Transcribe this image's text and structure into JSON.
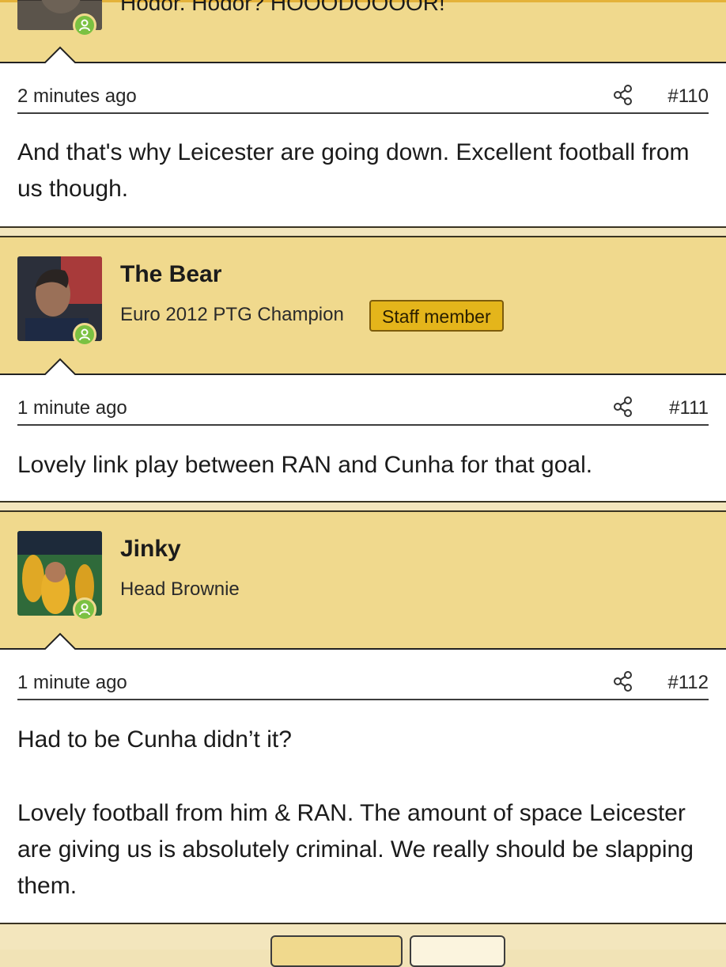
{
  "posts": [
    {
      "author_text": "Hodor. Hodor? HOOODOOOOR!",
      "time": "2 minutes ago",
      "number": "#110",
      "paragraphs": [
        "And that's why Leicester are going down. Excellent football from us though."
      ]
    },
    {
      "username": "The Bear",
      "user_title": "Euro 2012 PTG Champion",
      "badge": "Staff member",
      "time": "1 minute ago",
      "number": "#111",
      "paragraphs": [
        "Lovely link play between RAN and Cunha for that goal."
      ]
    },
    {
      "username": "Jinky",
      "user_title": "Head Brownie",
      "time": "1 minute ago",
      "number": "#112",
      "paragraphs": [
        "Had to be Cunha didn’t it?",
        "Lovely football from him & RAN. The amount of space Leicester are giving us is absolutely criminal. We really should be slapping them."
      ]
    }
  ],
  "icons": {
    "share": "share-icon",
    "online": "online-status-icon"
  },
  "colors": {
    "header_bg": "#f0d98d",
    "badge_bg": "#e4b51b",
    "online": "#7bc142",
    "post_bg": "#ffffff"
  }
}
